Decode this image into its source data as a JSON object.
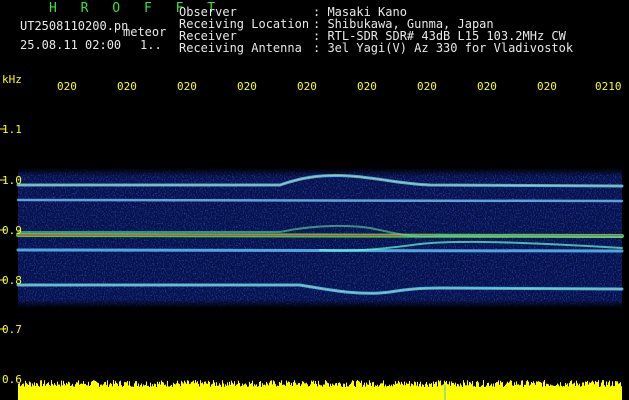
{
  "header": {
    "app_name": "H R O F F T",
    "file_name": "UT2508110200.pn",
    "mode": "meteor",
    "datetime": "25.08.11 02:00",
    "counter": "1..",
    "fields": [
      {
        "label": "Observer",
        "value": ": Masaki Kano"
      },
      {
        "label": "Receiving Location",
        "value": ": Shibukawa, Gunma, Japan"
      },
      {
        "label": "Receiver",
        "value": ": RTL-SDR SDR# 43dB L15 103.2MHz CW"
      },
      {
        "label": "Receiving Antenna",
        "value": ": 3el Yagi(V) Az 330 for Vladivostok"
      }
    ]
  },
  "axis": {
    "unit": "kHz",
    "y_ticks": [
      "1.1",
      "1.0",
      "0.9",
      "0.8",
      "0.7",
      "0.6"
    ],
    "x_ticks": [
      "020",
      "020",
      "020",
      "020",
      "020",
      "020",
      "020",
      "020",
      "020",
      "0210"
    ]
  },
  "colors": {
    "label_yellow": "#ffff00",
    "title_green": "#3ce03c",
    "text_white": "#e8e8e8",
    "spectrum_base": "#0a1a6a"
  }
}
